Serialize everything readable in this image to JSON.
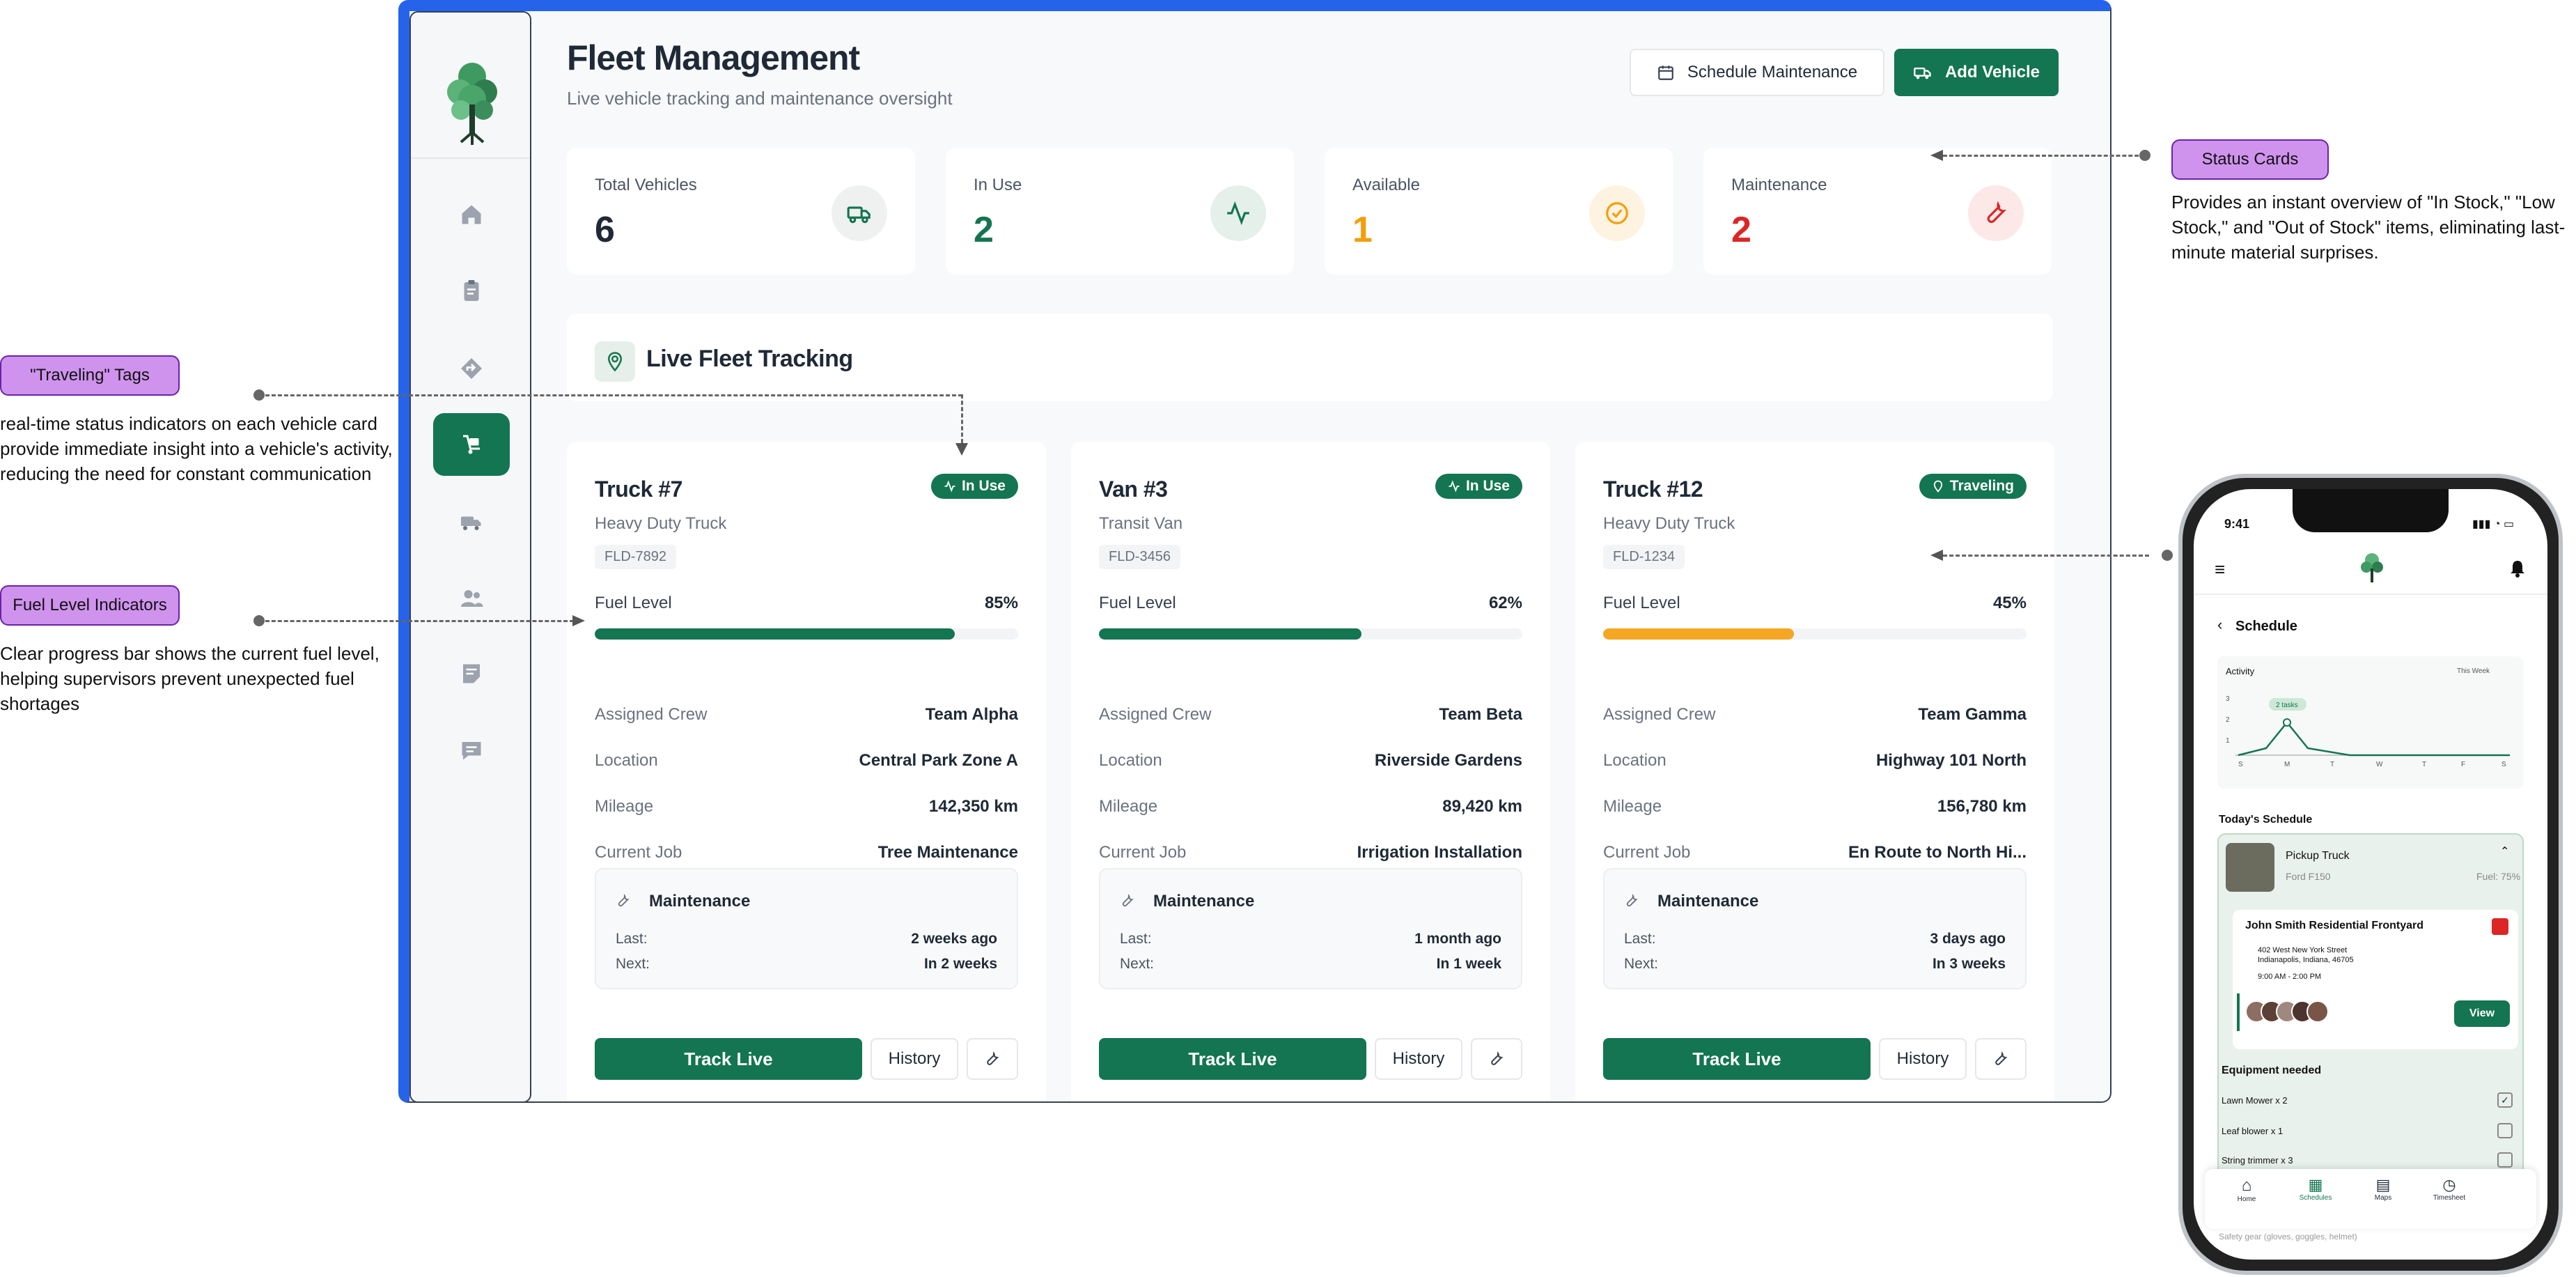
{
  "header": {
    "title": "Fleet Management",
    "subtitle": "Live vehicle tracking and maintenance oversight",
    "schedule_btn": "Schedule Maintenance",
    "add_btn": "Add Vehicle"
  },
  "stats": [
    {
      "label": "Total Vehicles",
      "value": "6",
      "color": "#1f2937",
      "icon": "truck-icon"
    },
    {
      "label": "In Use",
      "value": "2",
      "color": "#137551",
      "icon": "activity-icon"
    },
    {
      "label": "Available",
      "value": "1",
      "color": "#f59e0b",
      "icon": "check-circle-icon"
    },
    {
      "label": "Maintenance",
      "value": "2",
      "color": "#dc2626",
      "icon": "wrench-icon"
    }
  ],
  "tracking_title": "Live Fleet Tracking",
  "labels": {
    "fuel": "Fuel Level",
    "crew": "Assigned Crew",
    "location": "Location",
    "mileage": "Mileage",
    "job": "Current Job",
    "maintenance": "Maintenance",
    "last": "Last:",
    "next": "Next:",
    "track": "Track Live",
    "history": "History"
  },
  "vehicles": [
    {
      "name": "Truck #7",
      "type": "Heavy Duty Truck",
      "plate": "FLD-7892",
      "status": "In Use",
      "fuel": "85%",
      "fuel_fraction": 0.85,
      "fuel_color": "#137551",
      "crew": "Team Alpha",
      "location": "Central Park Zone A",
      "mileage": "142,350 km",
      "job": "Tree Maintenance",
      "last": "2 weeks ago",
      "next": "In 2 weeks"
    },
    {
      "name": "Van #3",
      "type": "Transit Van",
      "plate": "FLD-3456",
      "status": "In Use",
      "fuel": "62%",
      "fuel_fraction": 0.62,
      "fuel_color": "#137551",
      "crew": "Team Beta",
      "location": "Riverside Gardens",
      "mileage": "89,420 km",
      "job": "Irrigation Installation",
      "last": "1 month ago",
      "next": "In 1 week"
    },
    {
      "name": "Truck #12",
      "type": "Heavy Duty Truck",
      "plate": "FLD-1234",
      "status": "Traveling",
      "fuel": "45%",
      "fuel_fraction": 0.45,
      "fuel_color": "#f5a623",
      "crew": "Team Gamma",
      "location": "Highway 101 North",
      "mileage": "156,780 km",
      "job": "En Route to North Hi...",
      "last": "3 days ago",
      "next": "In 3 weeks"
    }
  ],
  "callouts": {
    "status": {
      "tag": "Status Cards",
      "desc": "Provides an instant overview of \"In Stock,\" \"Low Stock,\" and \"Out of Stock\" items, eliminating last-minute material surprises."
    },
    "traveling": {
      "tag": "\"Traveling\" Tags",
      "desc": "real-time status indicators on each vehicle card provide immediate insight into a vehicle's activity, reducing the need for constant communication"
    },
    "fuel": {
      "tag": "Fuel Level Indicators",
      "desc": "Clear progress bar shows the current fuel level, helping supervisors prevent unexpected fuel shortages"
    }
  },
  "phone": {
    "time": "9:41",
    "screen_title": "Schedule",
    "activity": "Activity",
    "period": "This Week",
    "tooltip": "2 tasks",
    "chart_days": [
      "S",
      "M",
      "T",
      "W",
      "T",
      "F",
      "S"
    ],
    "chart_y": [
      "3",
      "2",
      "1"
    ],
    "today": "Today's Schedule",
    "vehicle": "Pickup Truck",
    "model": "Ford F150",
    "fuel": "Fuel: 75%",
    "job_title": "John Smith Residential Frontyard",
    "address1": "402 West New York Street",
    "address2": "Indianapolis, Indiana, 46705",
    "hours": "9:00 AM - 2:00 PM",
    "view": "View",
    "equipment_title": "Equipment needed",
    "equipment": [
      {
        "name": "Lawn Mower x 2",
        "checked": true
      },
      {
        "name": "Leaf blower x 1",
        "checked": false
      },
      {
        "name": "String trimmer x 3",
        "checked": false
      }
    ],
    "extra": "Safety gear (gloves, goggles, helmet)",
    "tabs": [
      "Home",
      "Schedules",
      "Maps",
      "Timesheet"
    ]
  }
}
